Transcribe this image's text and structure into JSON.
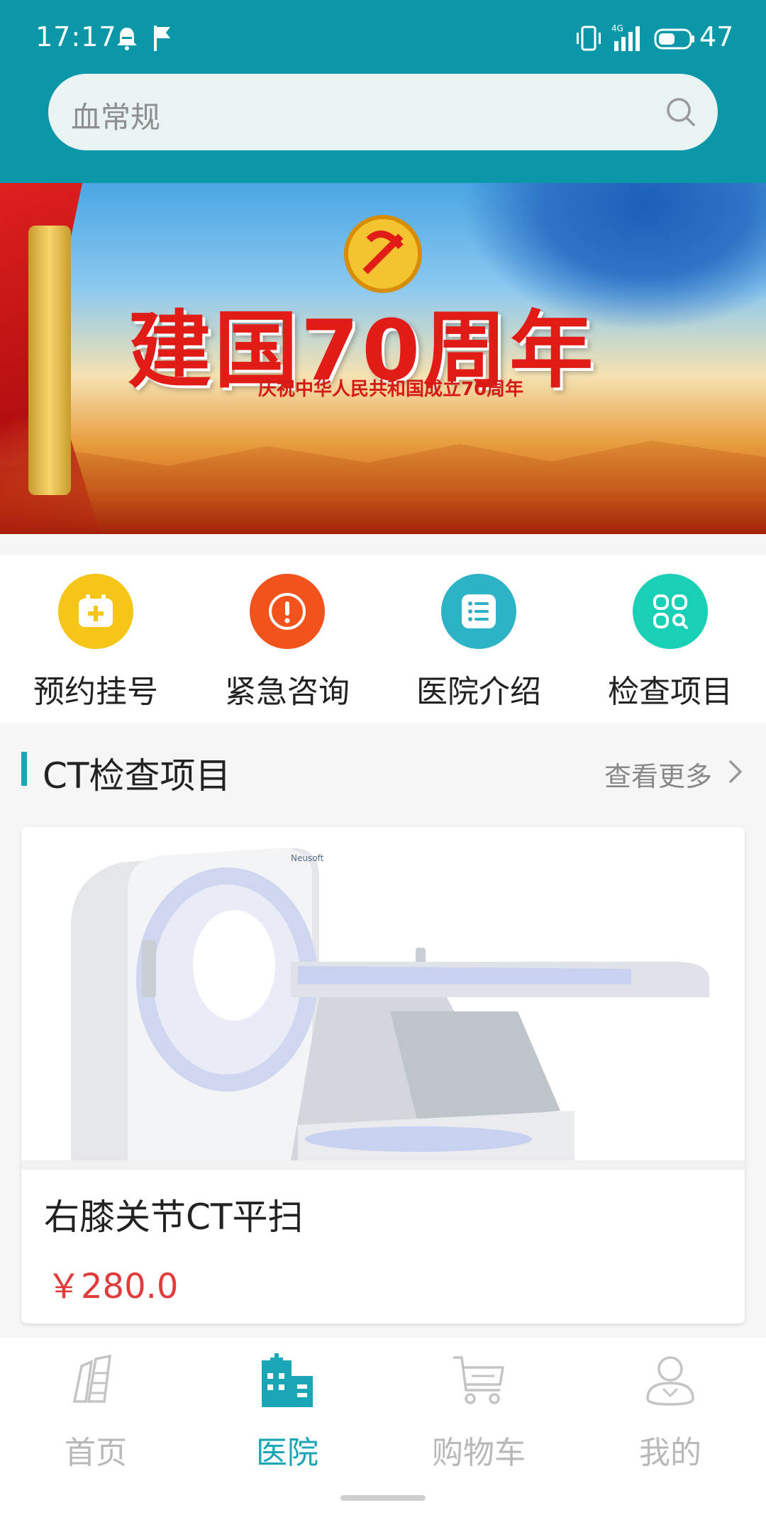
{
  "status_bar": {
    "time": "17:17",
    "battery": "47",
    "network": "4G"
  },
  "search": {
    "placeholder": "血常规"
  },
  "banner": {
    "headline": "建国70周年",
    "subtitle": "庆祝中华人民共和国成立70周年"
  },
  "quick_menu": [
    {
      "label": "预约挂号",
      "icon": "calendar-plus-icon",
      "color": "#f5c518"
    },
    {
      "label": "紧急咨询",
      "icon": "alert-icon",
      "color": "#f2521c"
    },
    {
      "label": "医院介绍",
      "icon": "list-icon",
      "color": "#2db3c6"
    },
    {
      "label": "检查项目",
      "icon": "grid-search-icon",
      "color": "#19cfb5"
    }
  ],
  "section": {
    "title": "CT检查项目",
    "more": "查看更多"
  },
  "product": {
    "name": "右膝关节CT平扫",
    "price": "￥280.0",
    "brand": "Neusoft"
  },
  "tabbar": [
    {
      "label": "首页",
      "icon": "building-icon",
      "active": false
    },
    {
      "label": "医院",
      "icon": "hospital-icon",
      "active": true
    },
    {
      "label": "购物车",
      "icon": "cart-icon",
      "active": false
    },
    {
      "label": "我的",
      "icon": "user-icon",
      "active": false
    }
  ],
  "colors": {
    "header": "#0b97a8",
    "accent": "#1aa6b7",
    "price": "#e23b3b"
  }
}
